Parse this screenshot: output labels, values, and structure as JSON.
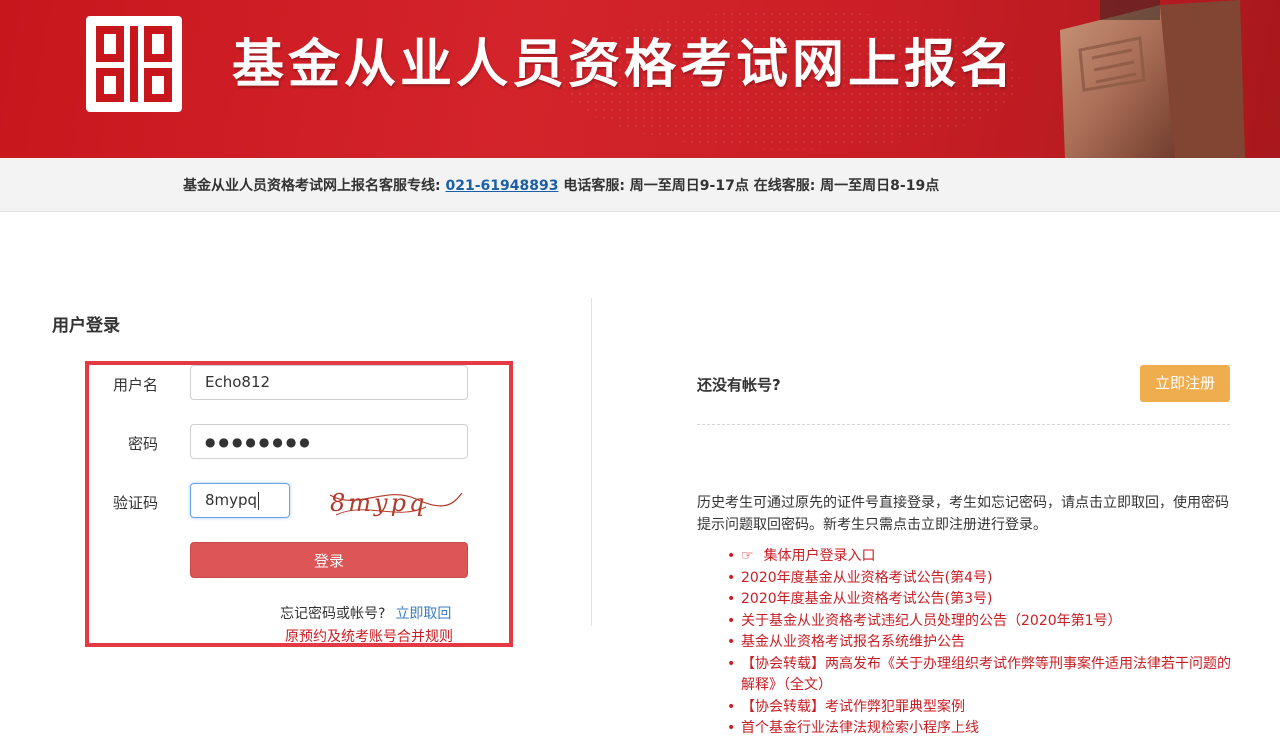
{
  "header": {
    "title": "基金从业人员资格考试网上报名"
  },
  "service": {
    "prefix": "基金从业人员资格考试网上报名客服专线: ",
    "phone": "021-61948893",
    "suffix": " 电话客服: 周一至周日9-17点 在线客服: 周一至周日8-19点"
  },
  "login": {
    "title": "用户登录",
    "username_label": "用户名",
    "username_value": "Echo812",
    "password_label": "密码",
    "password_mask": "●●●●●●●●",
    "captcha_label": "验证码",
    "captcha_value": "8mypq",
    "captcha_image_text": "8mypq",
    "submit_label": "登录",
    "forgot_text": "忘记密码或帐号?",
    "forgot_link": "立即取回",
    "merge_rule_link": "原预约及统考账号合并规则"
  },
  "register": {
    "prompt": "还没有帐号?",
    "button_label": "立即注册"
  },
  "notice": {
    "intro": "历史考生可通过原先的证件号直接登录，考生如忘记密码，请点击立即取回，使用密码提示问题取回密码。新考生只需点击立即注册进行登录。",
    "items": [
      "集体用户登录入口",
      "2020年度基金从业资格考试公告(第4号)",
      "2020年度基金从业资格考试公告(第3号)",
      "关于基金从业资格考试违纪人员处理的公告（2020年第1号）",
      "基金从业资格考试报名系统维护公告",
      "【协会转载】两高发布《关于办理组织考试作弊等刑事案件适用法律若干问题的解释》（全文）",
      "【协会转载】考试作弊犯罪典型案例",
      "首个基金行业法律法规检索小程序上线"
    ]
  },
  "colors": {
    "brand_red": "#c8161d",
    "login_button": "#dc5656",
    "register_button": "#f0ad4e",
    "highlight_border": "#e43a45",
    "link_blue": "#3a7cc4"
  }
}
